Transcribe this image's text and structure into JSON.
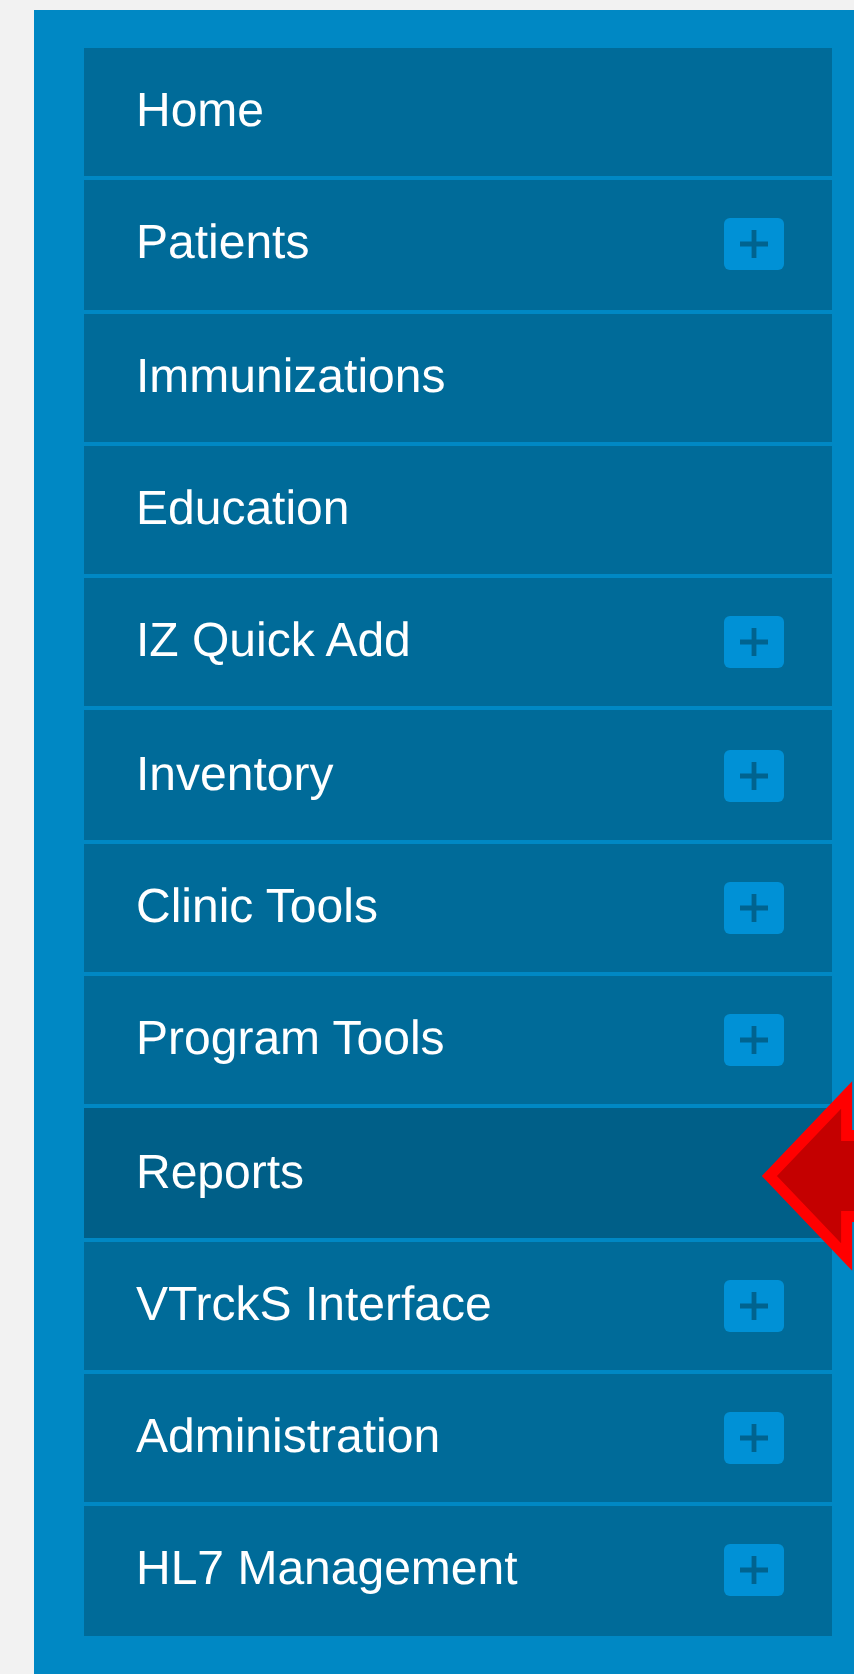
{
  "menu": [
    {
      "label": "Home",
      "expandable": false,
      "selected": false
    },
    {
      "label": "Patients",
      "expandable": true,
      "selected": false
    },
    {
      "label": "Immunizations",
      "expandable": false,
      "selected": false
    },
    {
      "label": "Education",
      "expandable": false,
      "selected": false
    },
    {
      "label": "IZ Quick Add",
      "expandable": true,
      "selected": false
    },
    {
      "label": "Inventory",
      "expandable": true,
      "selected": false
    },
    {
      "label": "Clinic Tools",
      "expandable": true,
      "selected": false
    },
    {
      "label": "Program Tools",
      "expandable": true,
      "selected": false
    },
    {
      "label": "Reports",
      "expandable": false,
      "selected": true
    },
    {
      "label": "VTrckS Interface",
      "expandable": true,
      "selected": false
    },
    {
      "label": "Administration",
      "expandable": true,
      "selected": false
    },
    {
      "label": "HL7 Management",
      "expandable": true,
      "selected": false
    }
  ]
}
